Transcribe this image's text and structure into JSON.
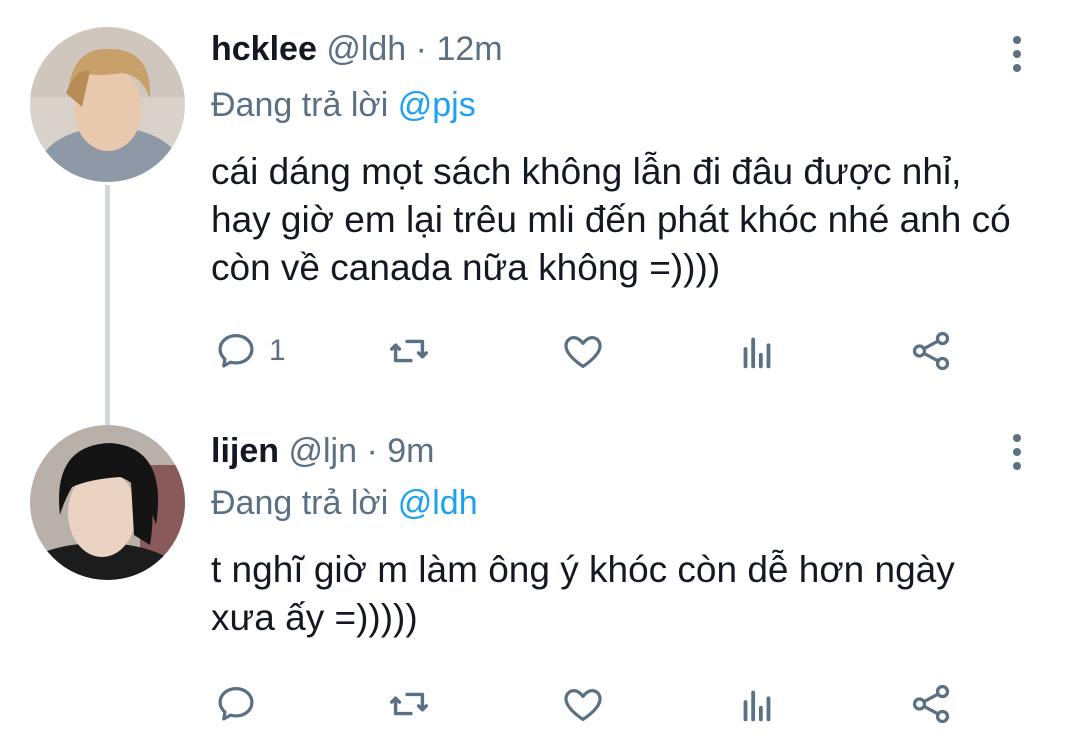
{
  "tweets": [
    {
      "display_name": "hcklee",
      "handle": "@ldh",
      "separator": "·",
      "time": "12m",
      "reply_prefix": "Đang trả lời",
      "reply_to": "@pjs",
      "text": "cái dáng mọt sách không lẫn đi đâu được nhỉ, hay giờ em lại trêu mli đến phát khóc nhé anh có còn về canada nữa không =))))",
      "reply_count": "1"
    },
    {
      "display_name": "lijen",
      "handle": "@ljn",
      "separator": "·",
      "time": "9m",
      "reply_prefix": "Đang trả lời",
      "reply_to": "@ldh",
      "text": "t nghĩ giờ m làm ông ý khóc còn dễ hơn ngày xưa ấy =)))))",
      "reply_count": ""
    }
  ],
  "icons": {
    "reply": "comment-icon",
    "retweet": "retweet-icon",
    "like": "heart-icon",
    "analytics": "analytics-icon",
    "share": "share-icon",
    "more": "more-vertical-icon"
  },
  "colors": {
    "text": "#141823",
    "secondary": "#5b7083",
    "mention": "#1da1f2",
    "thread_line": "#cfd9de"
  }
}
